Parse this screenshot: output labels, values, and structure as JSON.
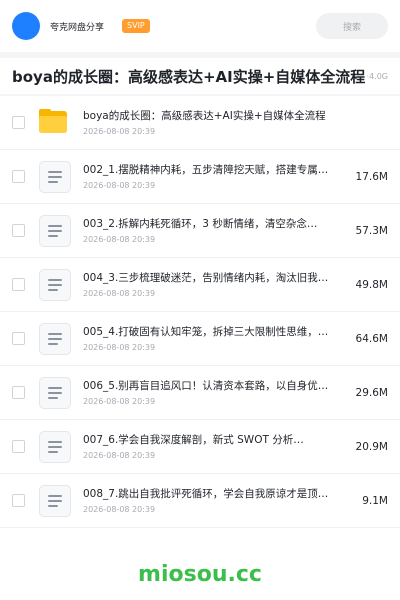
{
  "header": {
    "username": "夸克网盘分享",
    "badge": "SVIP",
    "search_placeholder": "搜索"
  },
  "share": {
    "title": "boya的成长圈：高级感表达+AI实操+自媒体全流程",
    "meta": "·4.0G"
  },
  "files": [
    {
      "type": "folder",
      "name": "boya的成长圈：高级感表达+AI实操+自媒体全流程",
      "date": "2026-08-08 20:39",
      "size": ""
    },
    {
      "type": "doc",
      "name": "002_1.摆脱精神内耗，五步清障挖天赋，搭建专属…",
      "date": "2026-08-08 20:39",
      "size": "17.6M"
    },
    {
      "type": "doc",
      "name": "003_2.拆解内耗死循环，3 秒断情绪，清空杂念…",
      "date": "2026-08-08 20:39",
      "size": "57.3M"
    },
    {
      "type": "doc",
      "name": "004_3.三步梳理破迷茫，告别情绪内耗，淘汰旧我…",
      "date": "2026-08-08 20:39",
      "size": "49.8M"
    },
    {
      "type": "doc",
      "name": "005_4.打破固有认知牢笼，拆掉三大限制性思维，…",
      "date": "2026-08-08 20:39",
      "size": "64.6M"
    },
    {
      "type": "doc",
      "name": "006_5.别再盲目追风口！认清资本套路，以自身优…",
      "date": "2026-08-08 20:39",
      "size": "29.6M"
    },
    {
      "type": "doc",
      "name": "007_6.学会自我深度解剖，新式 SWOT 分析…",
      "date": "2026-08-08 20:39",
      "size": "20.9M"
    },
    {
      "type": "doc",
      "name": "008_7.跳出自我批评死循环，学会自我原谅才是顶…",
      "date": "2026-08-08 20:39",
      "size": "9.1M"
    }
  ],
  "footer": {
    "watermark": "miosou.cc"
  },
  "colors": {
    "accent": "#1e80ff",
    "badge": "#ff9d2e",
    "folder": "#f7b500",
    "watermark": "#3cbf4a"
  }
}
